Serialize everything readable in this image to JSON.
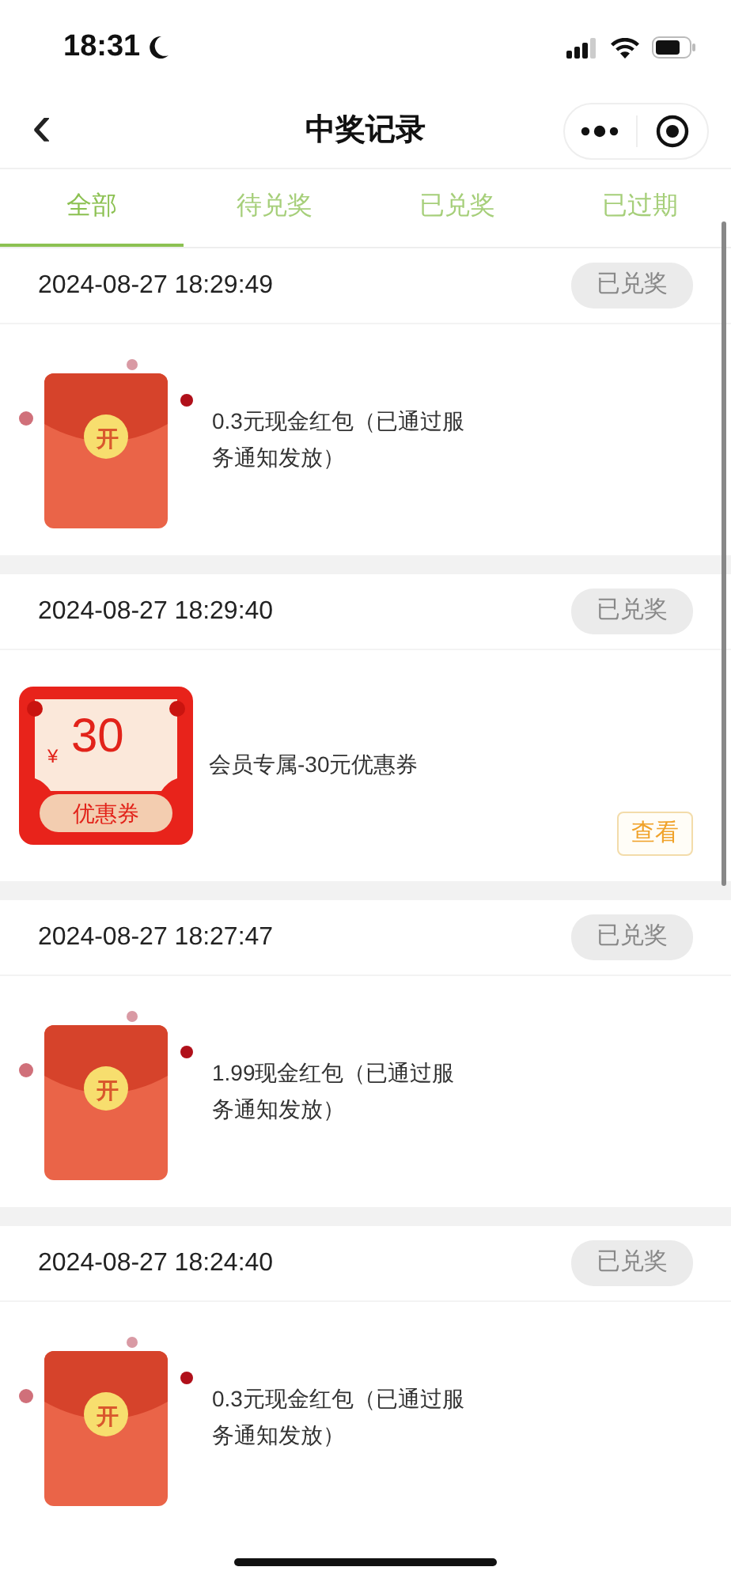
{
  "status_bar": {
    "time": "18:31"
  },
  "header": {
    "title": "中奖记录",
    "back": "‹"
  },
  "tabs": [
    {
      "label": "全部",
      "selected": true
    },
    {
      "label": "待兑奖",
      "selected": false
    },
    {
      "label": "已兑奖",
      "selected": false
    },
    {
      "label": "已过期",
      "selected": false
    }
  ],
  "records": [
    {
      "kind": "red_packet",
      "time": "2024-08-27 18:29:49",
      "status": "已兑奖",
      "seal": "开",
      "description": "0.3元现金红包（已通过服务通知发放）"
    },
    {
      "kind": "coupon",
      "time": "2024-08-27 18:29:40",
      "status": "已兑奖",
      "currency": "¥",
      "amount": "30",
      "coupon_label": "优惠券",
      "description": "会员专属-30元优惠券",
      "action": "查看"
    },
    {
      "kind": "red_packet",
      "time": "2024-08-27 18:27:47",
      "status": "已兑奖",
      "seal": "开",
      "description": "1.99现金红包（已通过服务通知发放）"
    },
    {
      "kind": "red_packet",
      "time": "2024-08-27 18:24:40",
      "status": "已兑奖",
      "seal": "开",
      "description": "0.3元现金红包（已通过服务通知发放）"
    }
  ]
}
